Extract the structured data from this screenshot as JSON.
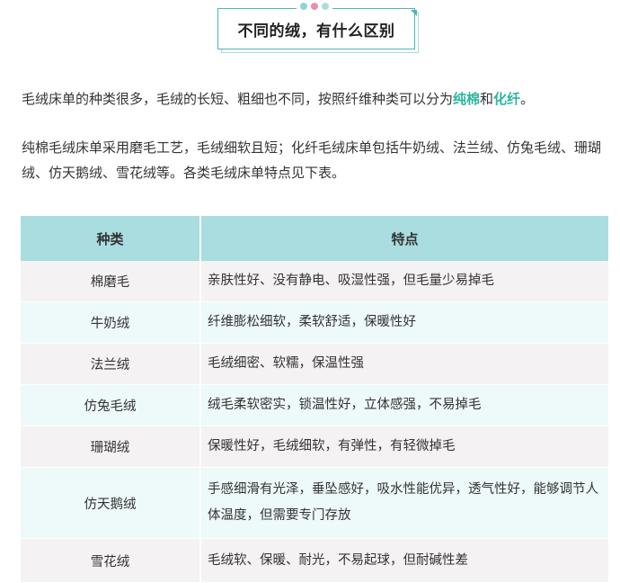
{
  "title": "不同的绒，有什么区别",
  "colors": {
    "accent": "#4fb3b8",
    "highlight": "#2bb5a0",
    "header_bg": "#a9dde0",
    "dot_blue": "#8fd3e0",
    "dot_pink": "#f08bb0",
    "dot_teal": "#a9dde0"
  },
  "paragraph1": {
    "before": "毛绒床单的种类很多，毛绒的长短、粗细也不同，按照纤维种类可以分为",
    "hl1": "纯棉",
    "mid": "和",
    "hl2": "化纤",
    "after": "。"
  },
  "paragraph2": "纯棉毛绒床单采用磨毛工艺，毛绒细软且短；化纤毛绒床单包括牛奶绒、法兰绒、仿兔毛绒、珊瑚绒、仿天鹅绒、雪花绒等。各类毛绒床单特点见下表。",
  "table": {
    "headers": [
      "种类",
      "特点"
    ],
    "rows": [
      {
        "type": "棉磨毛",
        "feature": "亲肤性好、没有静电、吸湿性强，但毛量少易掉毛"
      },
      {
        "type": "牛奶绒",
        "feature": "纤维膨松细软，柔软舒适，保暖性好"
      },
      {
        "type": "法兰绒",
        "feature": "毛绒细密、软糯，保温性强"
      },
      {
        "type": "仿兔毛绒",
        "feature": "绒毛柔软密实，锁温性好，立体感强，不易掉毛"
      },
      {
        "type": "珊瑚绒",
        "feature": "保暖性好，毛绒细软，有弹性，有轻微掉毛"
      },
      {
        "type": "仿天鹅绒",
        "feature": "手感细滑有光泽，垂坠感好，吸水性能优异，透气性好，能够调节人体温度，但需要专门存放"
      },
      {
        "type": "雪花绒",
        "feature": "毛绒软、保暖、耐光，不易起球，但耐碱性差"
      }
    ]
  }
}
